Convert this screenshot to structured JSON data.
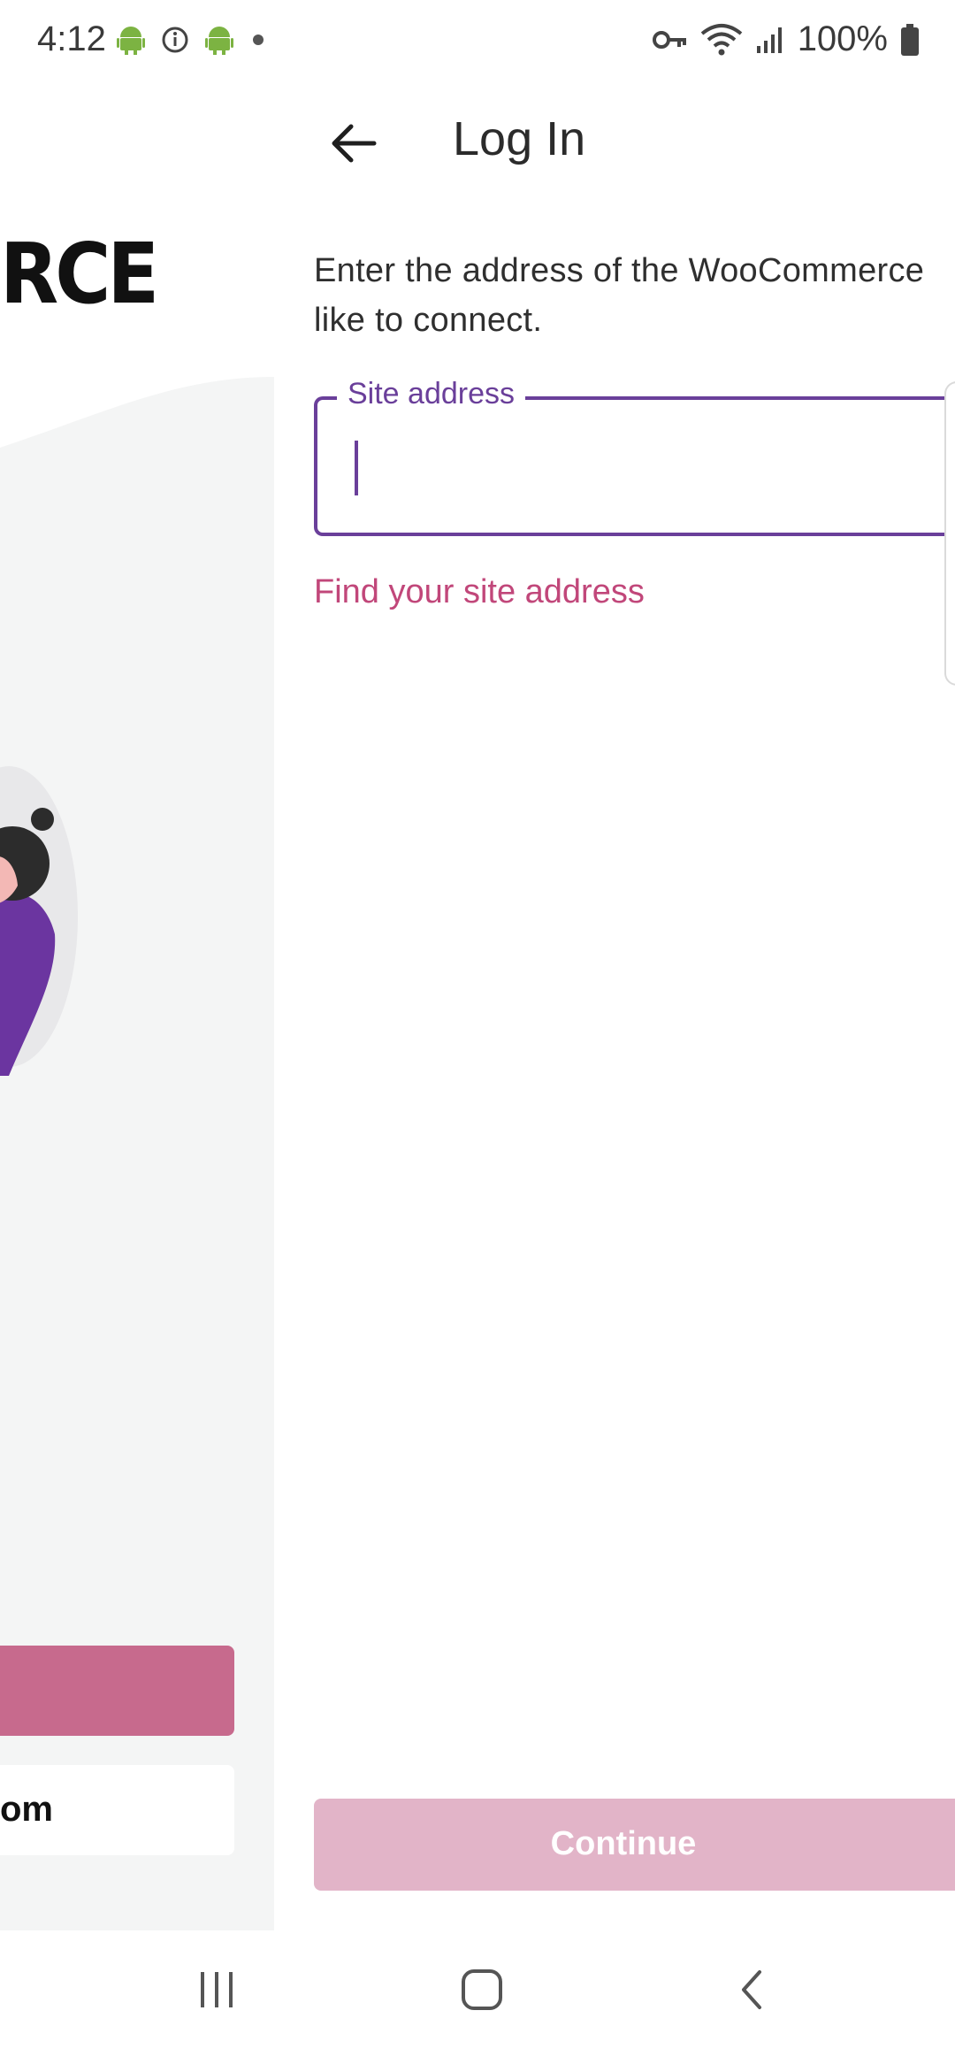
{
  "status_bar": {
    "time": "4:12",
    "battery_percent": "100%",
    "icons": [
      "android-icon",
      "info-icon",
      "android-icon",
      "dot-icon",
      "vpn-key-icon",
      "wifi-icon",
      "signal-icon",
      "battery-icon"
    ]
  },
  "background_screen": {
    "logo_fragment": "RCE",
    "secondary_button_fragment": "om"
  },
  "login": {
    "title": "Log In",
    "description": "Enter the address of the WooCommerce\nlike to connect.",
    "site_field": {
      "label": "Site address",
      "value": "",
      "placeholder": ""
    },
    "find_link": "Find your site address",
    "continue_label": "Continue"
  },
  "colors": {
    "accent_purple": "#6a3f9a",
    "link_pink": "#c1477a",
    "primary_disabled": "#e2b4c8",
    "bg_primary_button": "#c76a8d"
  },
  "nav_bar": {
    "buttons": [
      "recents-icon",
      "home-icon",
      "back-icon"
    ]
  }
}
